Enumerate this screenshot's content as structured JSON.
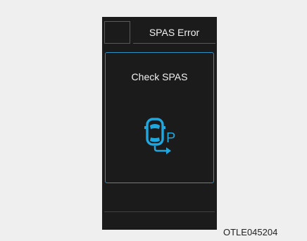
{
  "cluster": {
    "header": {
      "title": "SPAS Error"
    },
    "panel": {
      "message": "Check SPAS",
      "icon": "spas-parking-assist-icon",
      "indicator_letter": "P",
      "accent_color": "#1fa8e0"
    }
  },
  "caption": "OTLE045204"
}
